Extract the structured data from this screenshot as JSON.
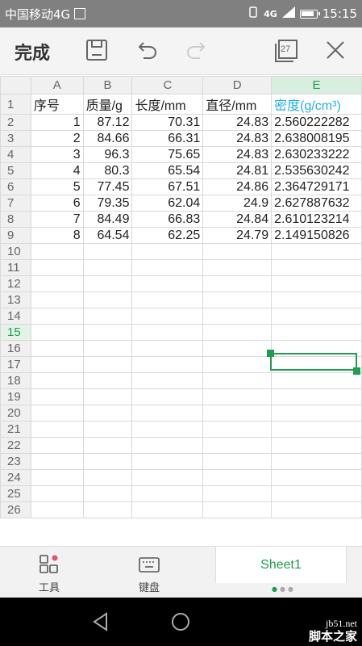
{
  "status_bar": {
    "carrier": "中国移动4G ",
    "network": "4G",
    "time": "15:15"
  },
  "toolbar": {
    "done_label": "完成",
    "redo_badge": "27"
  },
  "sheet": {
    "col_headers": [
      "A",
      "B",
      "C",
      "D",
      "E"
    ],
    "selected_col": "E",
    "selected_row": "15",
    "header_row": {
      "num": "1",
      "cells": [
        "序号",
        "质量/g",
        "长度/mm",
        "直径/mm",
        "密度(g/cm³)"
      ]
    },
    "rows": [
      {
        "num": "2",
        "cells": [
          "1",
          "87.12",
          "70.31",
          "24.83",
          "2.560222282"
        ]
      },
      {
        "num": "3",
        "cells": [
          "2",
          "84.66",
          "66.31",
          "24.83",
          "2.638008195"
        ]
      },
      {
        "num": "4",
        "cells": [
          "3",
          "96.3",
          "75.65",
          "24.83",
          "2.630233222"
        ]
      },
      {
        "num": "5",
        "cells": [
          "4",
          "80.3",
          "65.54",
          "24.81",
          "2.535630242"
        ]
      },
      {
        "num": "6",
        "cells": [
          "5",
          "77.45",
          "67.51",
          "24.86",
          "2.364729171"
        ]
      },
      {
        "num": "7",
        "cells": [
          "6",
          "79.35",
          "62.04",
          "24.9",
          "2.627887632"
        ]
      },
      {
        "num": "8",
        "cells": [
          "7",
          "84.49",
          "66.83",
          "24.84",
          "2.610123214"
        ]
      },
      {
        "num": "9",
        "cells": [
          "8",
          "64.54",
          "62.25",
          "24.79",
          "2.149150826"
        ]
      }
    ],
    "empty_rows": [
      "10",
      "11",
      "12",
      "13",
      "14",
      "15",
      "16",
      "17",
      "18",
      "19",
      "20",
      "21",
      "22",
      "23",
      "24",
      "25",
      "26"
    ]
  },
  "bottom_bar": {
    "tools_label": "工具",
    "keyboard_label": "键盘",
    "sheet_tab": "Sheet1"
  },
  "watermark": {
    "line1": "jb51.net",
    "line2": "脚本之家"
  },
  "colors": {
    "accent": "#1f9d4e",
    "header_highlight": "#25aee8",
    "status_bar": "#808080"
  }
}
